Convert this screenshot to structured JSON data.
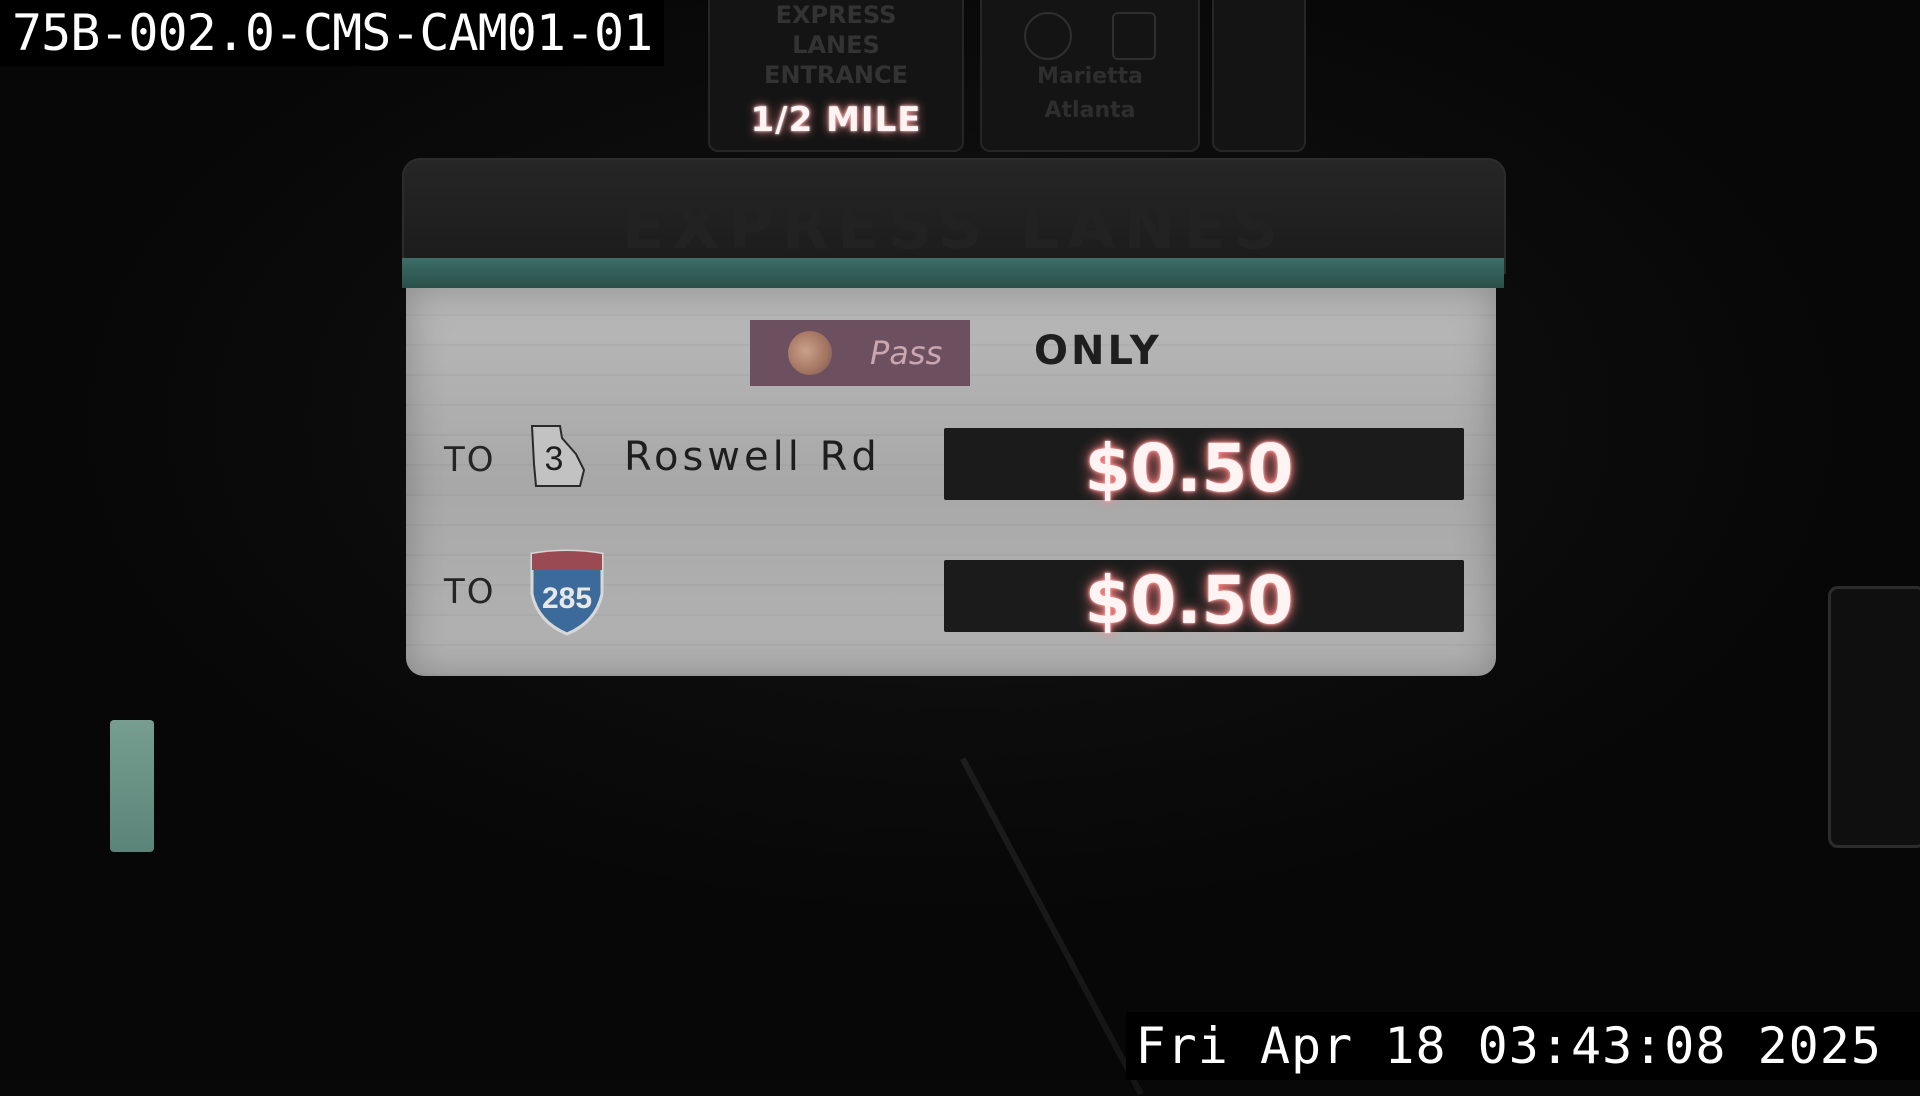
{
  "camera": {
    "id_label": "75B-002.0-CMS-CAM01-01",
    "timestamp": "Fri Apr 18 03:43:08 2025"
  },
  "overhead_signs": {
    "half_mile": "1/2 MILE",
    "partial_text_1": [
      "EXPRESS",
      "LANES",
      "ENTRANCE"
    ],
    "partial_text_2": [
      "Marietta",
      "Atlanta"
    ]
  },
  "toll_sign": {
    "header_text": "EXPRESS LANES",
    "pass_label": "Pass",
    "only_label": "ONLY",
    "rows": [
      {
        "to_label": "TO",
        "shield_number": "3",
        "route_name": "Roswell Rd",
        "price": "$0.50"
      },
      {
        "to_label": "TO",
        "shield_number": "285",
        "route_name": "",
        "price": "$0.50"
      }
    ]
  },
  "colors": {
    "price_glow": "#ff8080",
    "sign_panel": "#b3b3b3",
    "sign_strip": "#3c6e66",
    "pass_badge": "#6c5060"
  }
}
